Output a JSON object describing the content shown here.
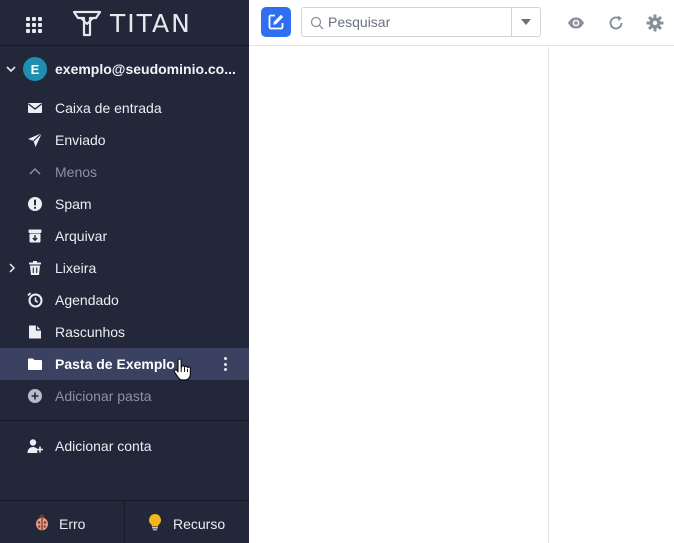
{
  "app": {
    "logo_text": "TITAN"
  },
  "account": {
    "avatar_letter": "E",
    "email": "exemplo@seudominio.co..."
  },
  "folders": [
    {
      "label": "Caixa de entrada",
      "icon": "inbox-icon"
    },
    {
      "label": "Enviado",
      "icon": "send-icon"
    },
    {
      "label": "Menos",
      "icon": "chevron-up-icon"
    },
    {
      "label": "Spam",
      "icon": "alert-icon"
    },
    {
      "label": "Arquivar",
      "icon": "archive-icon"
    },
    {
      "label": "Lixeira",
      "icon": "trash-icon"
    },
    {
      "label": "Agendado",
      "icon": "clock-icon"
    },
    {
      "label": "Rascunhos",
      "icon": "draft-icon"
    },
    {
      "label": "Pasta de Exemplo",
      "icon": "folder-icon"
    },
    {
      "label": "Adicionar pasta",
      "icon": "add-circle-icon"
    }
  ],
  "add_account": {
    "label": "Adicionar conta",
    "icon": "add-user-icon"
  },
  "footer": {
    "bug_label": "Erro",
    "bug_icon": "ladybug-icon",
    "feature_label": "Recurso",
    "feature_icon": "lightbulb-icon"
  },
  "toolbar": {
    "compose_icon": "compose-icon",
    "search_placeholder": "Pesquisar",
    "view_icon": "eye-icon",
    "refresh_icon": "refresh-icon",
    "settings_icon": "gear-icon"
  },
  "colors": {
    "sidebar_bg": "#22273a",
    "sidebar_active": "#3b4160",
    "accent": "#2e6ff0",
    "avatar": "#1f8fb0"
  }
}
